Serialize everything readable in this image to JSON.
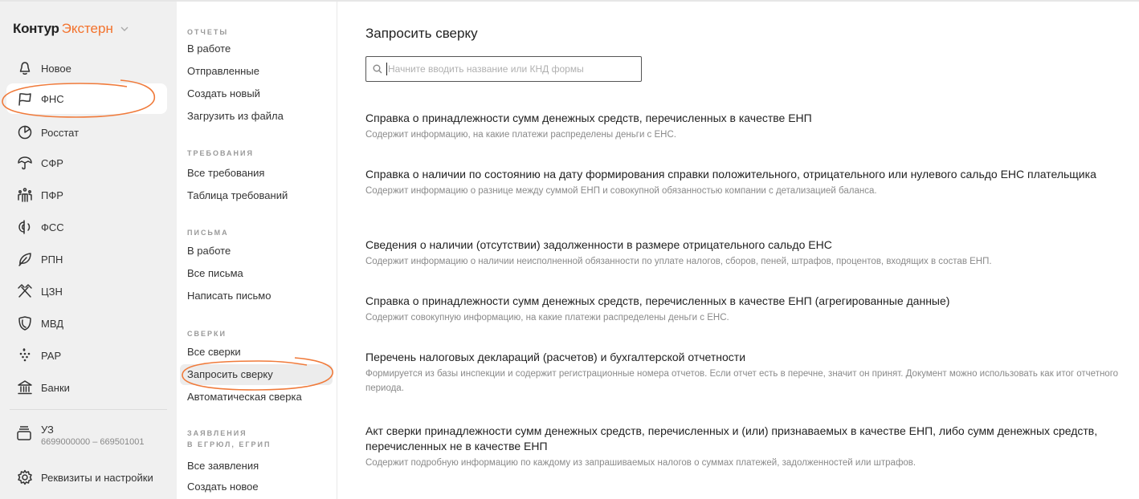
{
  "brand": {
    "name": "Контур",
    "product": "Экстерн",
    "accent": "#f3722c"
  },
  "sidebar": {
    "items": [
      {
        "label": "Новое",
        "icon": "bell-icon"
      },
      {
        "label": "ФНС",
        "icon": "flag-icon",
        "active": true
      },
      {
        "label": "Росстат",
        "icon": "pie-chart-icon"
      },
      {
        "label": "СФР",
        "icon": "umbrella-icon"
      },
      {
        "label": "ПФР",
        "icon": "people-icon"
      },
      {
        "label": "ФСС",
        "icon": "half-circle-icon"
      },
      {
        "label": "РПН",
        "icon": "leaf-icon"
      },
      {
        "label": "ЦЗН",
        "icon": "crossed-hammers-icon"
      },
      {
        "label": "МВД",
        "icon": "shield-icon"
      },
      {
        "label": "РАР",
        "icon": "grapes-icon"
      },
      {
        "label": "Банки",
        "icon": "bank-icon"
      }
    ],
    "org": {
      "name": "УЗ",
      "inn_kpp": "6699000000 – 669501001",
      "icon": "briefcase-icon"
    },
    "settings": {
      "label": "Реквизиты и настройки",
      "icon": "gear-icon"
    }
  },
  "nav": {
    "sections": [
      {
        "heading": "ОТЧЕТЫ",
        "links": [
          "В работе",
          "Отправленные",
          "Создать новый",
          "Загрузить из файла"
        ]
      },
      {
        "heading": "ТРЕБОВАНИЯ",
        "links": [
          "Все требования",
          "Таблица требований"
        ]
      },
      {
        "heading": "ПИСЬМА",
        "links": [
          "В работе",
          "Все письма",
          "Написать письмо"
        ]
      },
      {
        "heading": "СВЕРКИ",
        "links": [
          "Все сверки",
          "Запросить сверку",
          "Автоматическая сверка"
        ]
      },
      {
        "heading": "ЗАЯВЛЕНИЯ",
        "heading2": "В ЕГРЮЛ, ЕГРИП",
        "links": [
          "Все заявления",
          "Создать новое"
        ]
      }
    ],
    "active_link": "Запросить сверку"
  },
  "main": {
    "title": "Запросить сверку",
    "search": {
      "placeholder": "Начните вводить название или КНД формы",
      "value": ""
    },
    "documents": [
      {
        "title": "Справка о принадлежности сумм денежных средств, перечисленных в качестве ЕНП",
        "desc": "Содержит информацию, на какие платежи распределены деньги с ЕНС."
      },
      {
        "title": "Справка о наличии по состоянию на дату формирования справки положительного, отрицательного или нулевого сальдо ЕНС плательщика",
        "desc": "Содержит информацию о разнице между суммой ЕНП и совокупной обязанностью компании с детализацией баланса."
      },
      {
        "title": "Сведения о наличии (отсутствии) задолженности в размере отрицательного сальдо ЕНС",
        "desc": "Содержит информацию о наличии неисполненной обязанности по уплате налогов, сборов, пеней, штрафов, процентов, входящих в состав ЕНП."
      },
      {
        "title": "Справка о принадлежности сумм денежных средств, перечисленных в качестве ЕНП (агрегированные данные)",
        "desc": "Содержит совокупную информацию, на какие платежи распределены деньги с ЕНС."
      },
      {
        "title": "Перечень налоговых деклараций (расчетов) и бухгалтерской отчетности",
        "desc": "Формируется из базы инспекции и содержит регистрационные номера отчетов. Если отчет есть в перечне, значит он принят. Документ можно использовать как итог отчетного периода."
      },
      {
        "title": "Акт сверки принадлежности сумм денежных средств, перечисленных и (или) признаваемых в качестве ЕНП, либо сумм денежных средств, перечисленных не в качестве ЕНП",
        "desc": "Содержит подробную информацию по каждому из запрашиваемых налогов о суммах платежей, задолженностей или штрафов."
      }
    ]
  },
  "annotation_color": "#f07a3a"
}
